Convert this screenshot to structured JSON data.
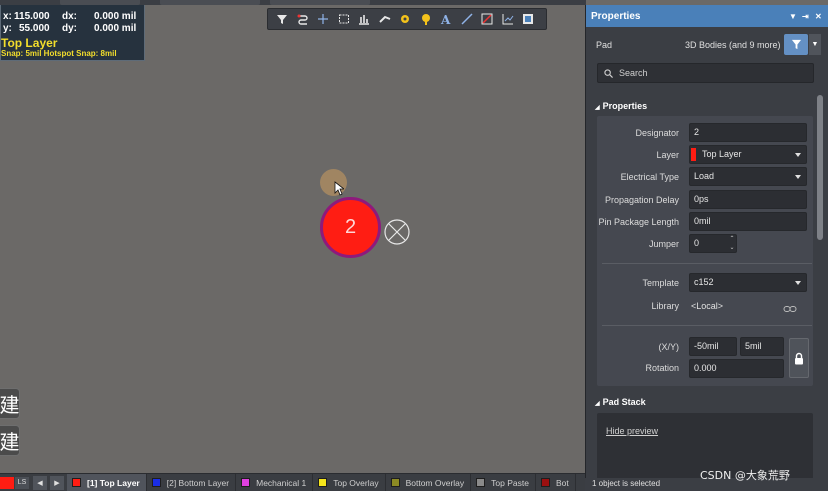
{
  "hud": {
    "row1_label": "x:",
    "row1_x": "115.000",
    "row1_dlabel": "dx:",
    "row1_d": "0.000 mil",
    "row2_label": "y:",
    "row2_y": "55.000",
    "row2_dlabel": "dy:",
    "row2_d": "0.000 mil",
    "layer": "Top Layer",
    "snap": "Snap: 5mil Hotspot Snap: 8mil"
  },
  "canvas": {
    "pad_designator": "2",
    "pad_color": "#ff1d13",
    "pad_outline_color": "#8e1a7c"
  },
  "side_buttons": [
    "建",
    "建"
  ],
  "toolbar": {
    "icons": [
      "filter-icon",
      "route-icon",
      "crosshair-icon",
      "rectangle-select-icon",
      "align-icon",
      "track-icon",
      "via-icon",
      "pad-icon",
      "text-icon",
      "line-icon",
      "keepout-icon",
      "graph-icon",
      "region-icon"
    ]
  },
  "layerbar": {
    "ls": "LS",
    "tabs": [
      {
        "label": "[1] Top Layer",
        "color": "#ff1d13",
        "active": true
      },
      {
        "label": "[2] Bottom Layer",
        "color": "#1a2ee6"
      },
      {
        "label": "Mechanical 1",
        "color": "#e040e0"
      },
      {
        "label": "Top Overlay",
        "color": "#f5e51c"
      },
      {
        "label": "Bottom Overlay",
        "color": "#8c8a24"
      },
      {
        "label": "Top Paste",
        "color": "#8a8a8a"
      },
      {
        "label": "Bot",
        "color": "#9a1010"
      }
    ]
  },
  "panel": {
    "title": "Properties",
    "object_type": "Pad",
    "filter_text": "3D Bodies (and 9 more)",
    "search_placeholder": "Search",
    "section_properties": "Properties",
    "designator_label": "Designator",
    "designator": "2",
    "layer_label": "Layer",
    "layer": "Top Layer",
    "layer_color": "#ff1d13",
    "electrical_type_label": "Electrical Type",
    "electrical_type": "Load",
    "propagation_delay_label": "Propagation Delay",
    "propagation_delay": "0ps",
    "pin_package_length_label": "Pin Package Length",
    "pin_package_length": "0mil",
    "jumper_label": "Jumper",
    "jumper": "0",
    "template_label": "Template",
    "template": "c152",
    "library_label": "Library",
    "library": "<Local>",
    "xy_label": "(X/Y)",
    "x": "-50mil",
    "y": "5mil",
    "rotation_label": "Rotation",
    "rotation": "0.000",
    "section_pad_stack": "Pad Stack",
    "hide_preview": "Hide preview",
    "status": "1 object is selected"
  },
  "watermark": "CSDN @大象荒野"
}
